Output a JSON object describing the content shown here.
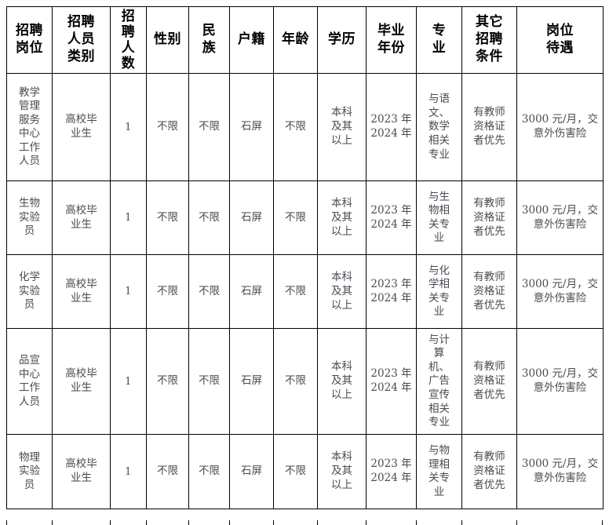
{
  "table": {
    "headers": [
      {
        "name": "position",
        "lines": [
          "招聘",
          "岗位"
        ],
        "stacked": false
      },
      {
        "name": "personnel-category",
        "lines": [
          "招聘",
          "人员",
          "类别"
        ],
        "stacked": false
      },
      {
        "name": "headcount",
        "lines": [
          "招",
          "聘",
          "人",
          "数"
        ],
        "stacked": true
      },
      {
        "name": "gender",
        "lines": [
          "性别"
        ],
        "stacked": false
      },
      {
        "name": "ethnicity",
        "lines": [
          "民",
          "族"
        ],
        "stacked": false
      },
      {
        "name": "household-registration",
        "lines": [
          "户籍"
        ],
        "stacked": false
      },
      {
        "name": "age",
        "lines": [
          "年龄"
        ],
        "stacked": false
      },
      {
        "name": "education",
        "lines": [
          "学历"
        ],
        "stacked": false
      },
      {
        "name": "graduation-year",
        "lines": [
          "毕业",
          "年份"
        ],
        "stacked": false
      },
      {
        "name": "major",
        "lines": [
          "专",
          "业"
        ],
        "stacked": false
      },
      {
        "name": "other-conditions",
        "lines": [
          "其它",
          "招聘",
          "条件"
        ],
        "stacked": false
      },
      {
        "name": "position-treatment",
        "lines": [
          "岗位",
          "待遇"
        ],
        "stacked": false
      }
    ],
    "rows": [
      {
        "position": [
          "教学",
          "管理",
          "服务",
          "中心",
          "工作",
          "人员"
        ],
        "category": [
          "高校毕",
          "业生"
        ],
        "headcount": [
          "1"
        ],
        "gender": [
          "不限"
        ],
        "ethnicity": [
          "不限"
        ],
        "household": [
          "石屏"
        ],
        "age": [
          "不限"
        ],
        "education": [
          "本科",
          "及其",
          "以上"
        ],
        "graduation": [
          "2023 年",
          "2024 年"
        ],
        "major": [
          "与语",
          "文、",
          "数学",
          "相关",
          "专业"
        ],
        "other": [
          "有教师",
          "资格证",
          "者优先"
        ],
        "treatment": [
          "3000 元/月，交",
          "意外伤害险"
        ]
      },
      {
        "position": [
          "生物",
          "实验",
          "员"
        ],
        "category": [
          "高校毕",
          "业生"
        ],
        "headcount": [
          "1"
        ],
        "gender": [
          "不限"
        ],
        "ethnicity": [
          "不限"
        ],
        "household": [
          "石屏"
        ],
        "age": [
          "不限"
        ],
        "education": [
          "本科",
          "及其",
          "以上"
        ],
        "graduation": [
          "2023 年",
          "2024 年"
        ],
        "major": [
          "与生",
          "物相",
          "关专",
          "业"
        ],
        "other": [
          "有教师",
          "资格证",
          "者优先"
        ],
        "treatment": [
          "3000 元/月，交",
          "意外伤害险"
        ]
      },
      {
        "position": [
          "化学",
          "实验",
          "员"
        ],
        "category": [
          "高校毕",
          "业生"
        ],
        "headcount": [
          "1"
        ],
        "gender": [
          "不限"
        ],
        "ethnicity": [
          "不限"
        ],
        "household": [
          "石屏"
        ],
        "age": [
          "不限"
        ],
        "education": [
          "本科",
          "及其",
          "以上"
        ],
        "graduation": [
          "2023 年",
          "2024 年"
        ],
        "major": [
          "与化",
          "学相",
          "关专",
          "业"
        ],
        "other": [
          "有教师",
          "资格证",
          "者优先"
        ],
        "treatment": [
          "3000 元/月，交",
          "意外伤害险"
        ]
      },
      {
        "position": [
          "品宣",
          "中心",
          "工作",
          "人员"
        ],
        "category": [
          "高校毕",
          "业生"
        ],
        "headcount": [
          "1"
        ],
        "gender": [
          "不限"
        ],
        "ethnicity": [
          "不限"
        ],
        "household": [
          "石屏"
        ],
        "age": [
          "不限"
        ],
        "education": [
          "本科",
          "及其",
          "以上"
        ],
        "graduation": [
          "2023 年",
          "2024 年"
        ],
        "major": [
          "与计",
          "算",
          "机、",
          "广告",
          "宣传",
          "相关",
          "专业"
        ],
        "other": [
          "有教师",
          "资格证",
          "者优先"
        ],
        "treatment": [
          "3000 元/月，交",
          "意外伤害险"
        ]
      },
      {
        "position": [
          "物理",
          "实验",
          "员"
        ],
        "category": [
          "高校毕",
          "业生"
        ],
        "headcount": [
          "1"
        ],
        "gender": [
          "不限"
        ],
        "ethnicity": [
          "不限"
        ],
        "household": [
          "石屏"
        ],
        "age": [
          "不限"
        ],
        "education": [
          "本科",
          "及其",
          "以上"
        ],
        "graduation": [
          "2023 年",
          "2024 年"
        ],
        "major": [
          "与物",
          "理相",
          "关专",
          "业"
        ],
        "other": [
          "有教师",
          "资格证",
          "者优先"
        ],
        "treatment": [
          "3000 元/月，交",
          "意外伤害险"
        ]
      }
    ],
    "colors": {
      "border": "#000000",
      "header_text": "#000000",
      "body_text": "#4a4a52",
      "background": "#ffffff"
    }
  }
}
